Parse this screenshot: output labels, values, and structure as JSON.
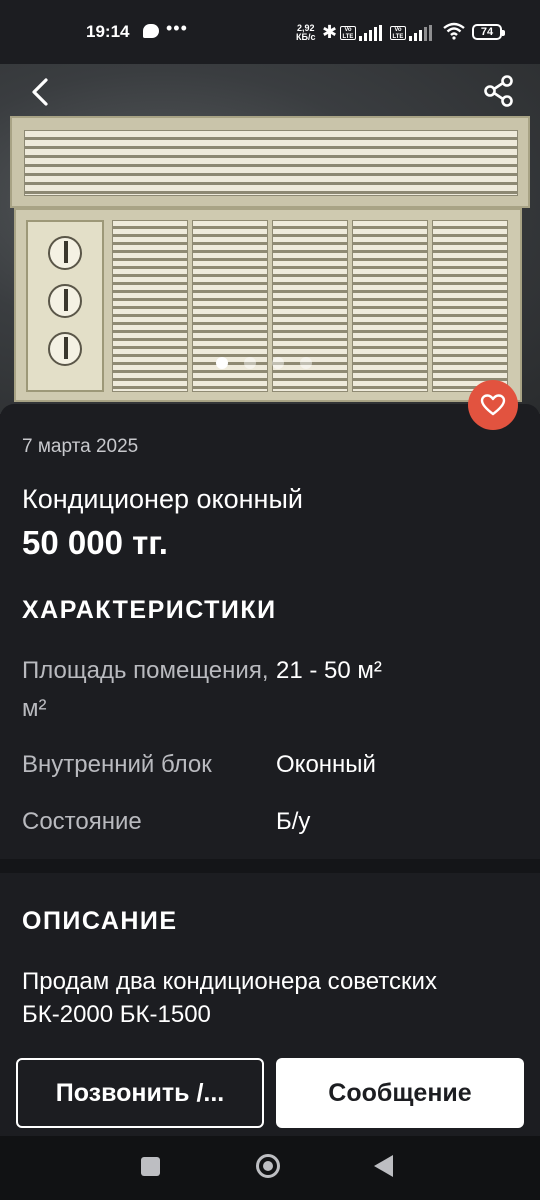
{
  "status_bar": {
    "time": "19:14",
    "speed_value": "2,92",
    "speed_unit": "КБ/с",
    "lte1": "Vo LTE",
    "lte2": "Vo LTE",
    "battery": "74"
  },
  "gallery": {
    "image_alt": "Кондиционер оконный",
    "current_photo": 1,
    "photo_count": 4
  },
  "listing": {
    "date": "7 марта 2025",
    "title": "Кондиционер оконный",
    "price": "50 000 тг."
  },
  "specs": {
    "heading": "ХАРАКТЕРИСТИКИ",
    "rows": [
      {
        "label": "Площадь помещения, м²",
        "value": "21 - 50 м²"
      },
      {
        "label": "Внутренний блок",
        "value": "Оконный"
      },
      {
        "label": "Состояние",
        "value": "Б/у"
      }
    ]
  },
  "description": {
    "heading": "ОПИСАНИЕ",
    "text": "Продам два кондиционера советских БК-2000 БК-1500"
  },
  "actions": {
    "call_label": "Позвонить /...",
    "message_label": "Сообщение"
  },
  "colors": {
    "background": "#1c1d21",
    "favorite": "#e2533f"
  }
}
